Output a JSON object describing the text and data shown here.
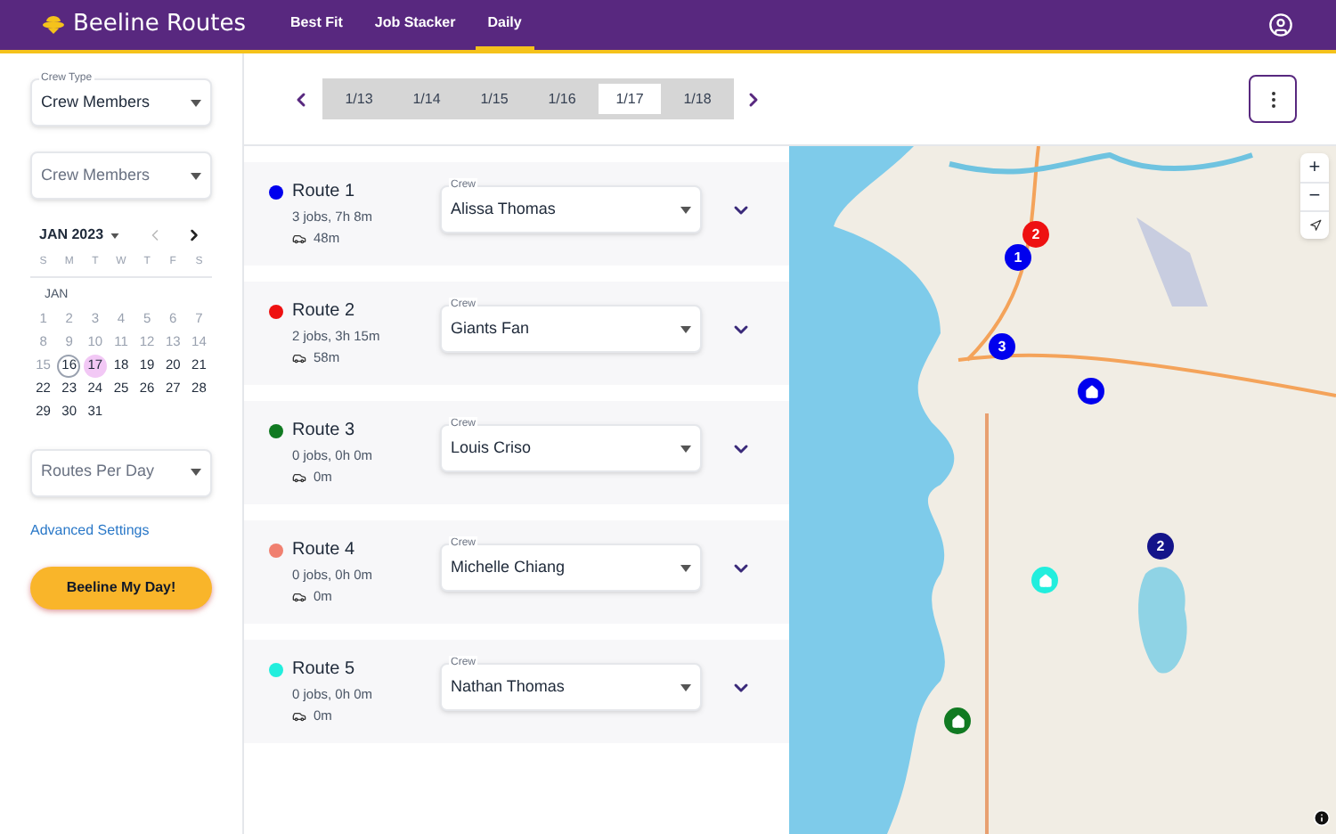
{
  "header": {
    "brand": "Beeline Routes",
    "tabs": [
      {
        "label": "Best Fit",
        "selected": false
      },
      {
        "label": "Job Stacker",
        "selected": false
      },
      {
        "label": "Daily",
        "selected": true
      }
    ]
  },
  "sidebar": {
    "crew_type": {
      "label": "Crew Type",
      "value": "Crew Members"
    },
    "crew_members": {
      "placeholder": "Crew Members"
    },
    "calendar": {
      "month": "JAN 2023",
      "weekdays": [
        "S",
        "M",
        "T",
        "W",
        "T",
        "F",
        "S"
      ],
      "month_label": "JAN",
      "weeks": [
        [
          {
            "day": "1",
            "disabled": true,
            "today": false,
            "selected": false
          },
          {
            "day": "2",
            "disabled": true,
            "today": false,
            "selected": false
          },
          {
            "day": "3",
            "disabled": true,
            "today": false,
            "selected": false
          },
          {
            "day": "4",
            "disabled": true,
            "today": false,
            "selected": false
          },
          {
            "day": "5",
            "disabled": true,
            "today": false,
            "selected": false
          },
          {
            "day": "6",
            "disabled": true,
            "today": false,
            "selected": false
          },
          {
            "day": "7",
            "disabled": true,
            "today": false,
            "selected": false
          }
        ],
        [
          {
            "day": "8",
            "disabled": true,
            "today": false,
            "selected": false
          },
          {
            "day": "9",
            "disabled": true,
            "today": false,
            "selected": false
          },
          {
            "day": "10",
            "disabled": true,
            "today": false,
            "selected": false
          },
          {
            "day": "11",
            "disabled": true,
            "today": false,
            "selected": false
          },
          {
            "day": "12",
            "disabled": true,
            "today": false,
            "selected": false
          },
          {
            "day": "13",
            "disabled": true,
            "today": false,
            "selected": false
          },
          {
            "day": "14",
            "disabled": true,
            "today": false,
            "selected": false
          }
        ],
        [
          {
            "day": "15",
            "disabled": true,
            "today": false,
            "selected": false
          },
          {
            "day": "16",
            "disabled": false,
            "today": true,
            "selected": false
          },
          {
            "day": "17",
            "disabled": false,
            "today": false,
            "selected": true
          },
          {
            "day": "18",
            "disabled": false,
            "today": false,
            "selected": false
          },
          {
            "day": "19",
            "disabled": false,
            "today": false,
            "selected": false
          },
          {
            "day": "20",
            "disabled": false,
            "today": false,
            "selected": false
          },
          {
            "day": "21",
            "disabled": false,
            "today": false,
            "selected": false
          }
        ],
        [
          {
            "day": "22",
            "disabled": false,
            "today": false,
            "selected": false
          },
          {
            "day": "23",
            "disabled": false,
            "today": false,
            "selected": false
          },
          {
            "day": "24",
            "disabled": false,
            "today": false,
            "selected": false
          },
          {
            "day": "25",
            "disabled": false,
            "today": false,
            "selected": false
          },
          {
            "day": "26",
            "disabled": false,
            "today": false,
            "selected": false
          },
          {
            "day": "27",
            "disabled": false,
            "today": false,
            "selected": false
          },
          {
            "day": "28",
            "disabled": false,
            "today": false,
            "selected": false
          }
        ],
        [
          {
            "day": "29",
            "disabled": false,
            "today": false,
            "selected": false
          },
          {
            "day": "30",
            "disabled": false,
            "today": false,
            "selected": false
          },
          {
            "day": "31",
            "disabled": false,
            "today": false,
            "selected": false
          }
        ]
      ]
    },
    "routes_per_day": {
      "placeholder": "Routes Per Day"
    },
    "advanced_link": "Advanced Settings",
    "action_button": "Beeline My Day!"
  },
  "dates": [
    {
      "label": "1/13",
      "selected": false
    },
    {
      "label": "1/14",
      "selected": false
    },
    {
      "label": "1/15",
      "selected": false
    },
    {
      "label": "1/16",
      "selected": false
    },
    {
      "label": "1/17",
      "selected": true
    },
    {
      "label": "1/18",
      "selected": false
    }
  ],
  "routes": [
    {
      "name": "Route 1",
      "color": "#0000ee",
      "summary": "3 jobs, 7h 8m",
      "drive": "48m",
      "crew_label": "Crew",
      "crew": "Alissa Thomas"
    },
    {
      "name": "Route 2",
      "color": "#ee1111",
      "summary": "2 jobs, 3h 15m",
      "drive": "58m",
      "crew_label": "Crew",
      "crew": "Giants Fan"
    },
    {
      "name": "Route 3",
      "color": "#117a22",
      "summary": "0 jobs, 0h 0m",
      "drive": "0m",
      "crew_label": "Crew",
      "crew": "Louis Criso"
    },
    {
      "name": "Route 4",
      "color": "#f08070",
      "summary": "0 jobs, 0h 0m",
      "drive": "0m",
      "crew_label": "Crew",
      "crew": "Michelle Chiang"
    },
    {
      "name": "Route 5",
      "color": "#22eedd",
      "summary": "0 jobs, 0h 0m",
      "drive": "0m",
      "crew_label": "Crew",
      "crew": "Nathan Thomas"
    }
  ],
  "map": {
    "markers": [
      {
        "kind": "number",
        "label": "2",
        "color": "#ee1111"
      },
      {
        "kind": "number",
        "label": "1",
        "color": "#0000ee"
      },
      {
        "kind": "number",
        "label": "3",
        "color": "#0000ee"
      },
      {
        "kind": "home",
        "color": "#0000ee"
      },
      {
        "kind": "number",
        "label": "2",
        "color": "#14148a"
      },
      {
        "kind": "home",
        "color": "#22eedd"
      },
      {
        "kind": "home",
        "color": "#117a22"
      }
    ],
    "zoom_in": "+",
    "zoom_out": "−"
  }
}
